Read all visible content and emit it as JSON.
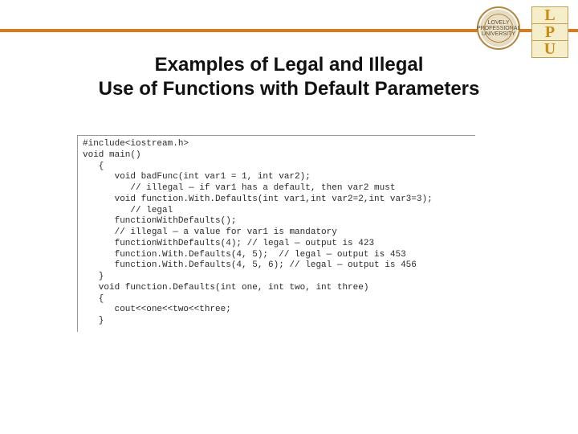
{
  "header": {
    "circle_text": "LOVELY PROFESSIONAL UNIVERSITY",
    "logo_letters": [
      "L",
      "P",
      "U"
    ]
  },
  "title": {
    "line1": "Examples of Legal and Illegal",
    "line2": "Use of Functions with Default Parameters"
  },
  "code": "#include<iostream.h>\nvoid main()\n   {\n      void badFunc(int var1 = 1, int var2);\n         // illegal — if var1 has a default, then var2 must\n      void function.With.Defaults(int var1,int var2=2,int var3=3);\n         // legal\n      functionWithDefaults();\n      // illegal — a value for var1 is mandatory\n      functionWithDefaults(4); // legal — output is 423\n      function.With.Defaults(4, 5);  // legal — output is 453\n      function.With.Defaults(4, 5, 6); // legal — output is 456\n   }\n   void function.Defaults(int one, int two, int three)\n   {\n      cout<<one<<two<<three;\n   }"
}
